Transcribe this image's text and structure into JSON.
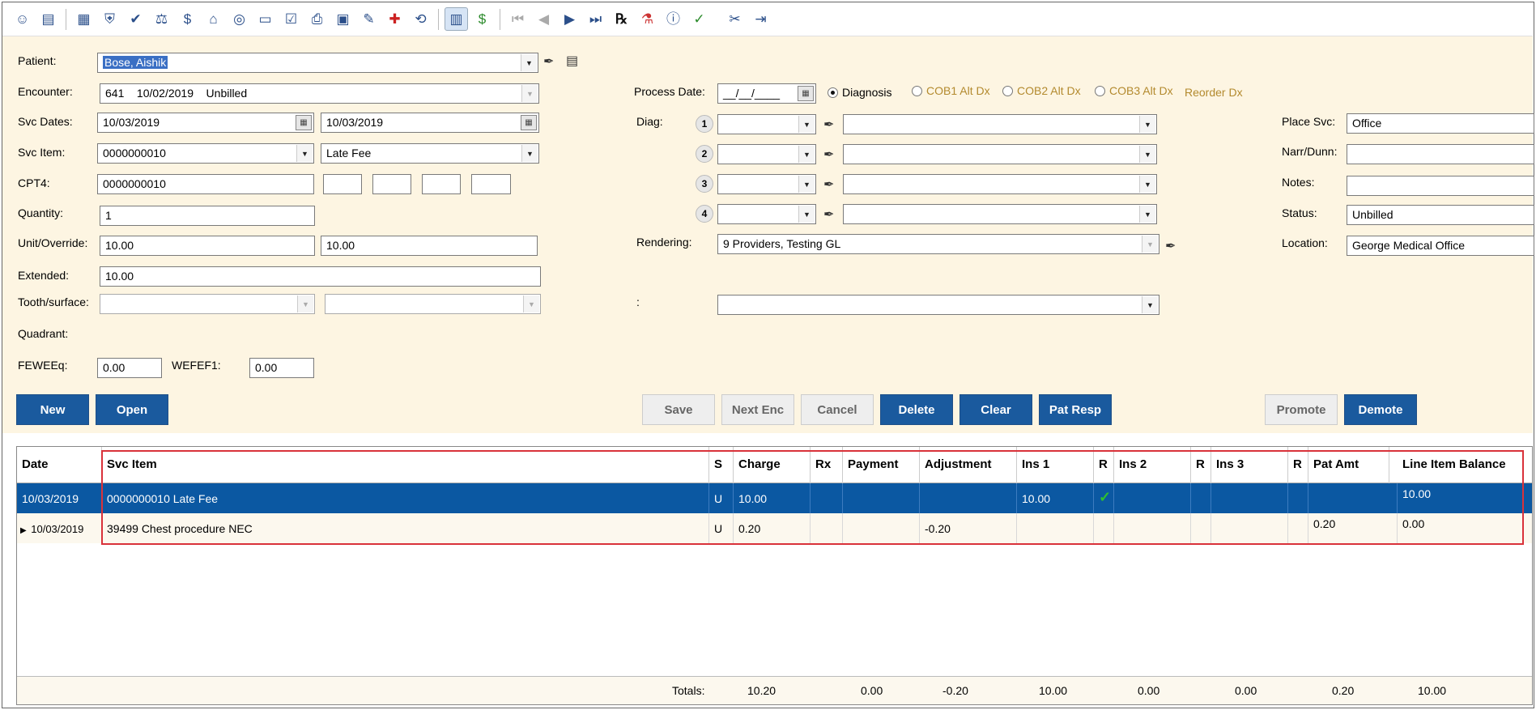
{
  "toolbar": {
    "icons": [
      "patient-icon",
      "card-icon",
      "calendar-grid-icon",
      "shield-icon",
      "shield-check-icon",
      "scales-icon",
      "user-dollar-icon",
      "bank-icon",
      "lifebuoy-icon",
      "ledger-icon",
      "checklist-icon",
      "printer-icon",
      "monitor-icon",
      "tag-icon",
      "medical-plus-icon",
      "reverse-icon",
      "table-icon",
      "dollar-icon",
      "first-icon",
      "prev-icon",
      "next-icon",
      "last-icon",
      "rx-icon",
      "flask-icon",
      "chart-info-icon",
      "chart-check-icon",
      "ticket-icon",
      "exit-icon"
    ]
  },
  "form": {
    "patient_label": "Patient:",
    "patient_value": "Bose, Aishik",
    "encounter_label": "Encounter:",
    "encounter_value": "641    10/02/2019    Unbilled",
    "svc_dates_label": "Svc Dates:",
    "svc_date_from": "10/03/2019",
    "svc_date_to": "10/03/2019",
    "svc_item_label": "Svc Item:",
    "svc_item_code": "0000000010",
    "svc_item_desc": "Late Fee",
    "cpt4_label": "CPT4:",
    "cpt4_value": "0000000010",
    "quantity_label": "Quantity:",
    "quantity_value": "1",
    "unit_override_label": "Unit/Override:",
    "unit_value": "10.00",
    "override_value": "10.00",
    "extended_label": "Extended:",
    "extended_value": "10.00",
    "tooth_label": "Tooth/surface:",
    "quadrant_label": "Quadrant:",
    "feweeq_label": "FEWEEq:",
    "feweeq_value": "0.00",
    "wefef1_label": "WEFEF1:",
    "wefef1_value": "0.00",
    "process_date_label": "Process Date:",
    "process_date_value": "__/__/____",
    "radio_diagnosis": "Diagnosis",
    "radio_cob1": "COB1 Alt Dx",
    "radio_cob2": "COB2 Alt Dx",
    "radio_cob3": "COB3 Alt Dx",
    "reorder_dx": "Reorder Dx",
    "diag_label": "Diag:",
    "diag_numbers": [
      "1",
      "2",
      "3",
      "4"
    ],
    "rendering_label": "Rendering:",
    "rendering_value": "9 Providers, Testing GL",
    "colon_label": ":",
    "place_svc_label": "Place Svc:",
    "place_svc_value": "Office",
    "narr_dunn_label": "Narr/Dunn:",
    "notes_label": "Notes:",
    "status_label": "Status:",
    "status_value": "Unbilled",
    "location_label": "Location:",
    "location_value": "George Medical Office"
  },
  "buttons": {
    "new": "New",
    "open": "Open",
    "save": "Save",
    "next_enc": "Next Enc",
    "cancel": "Cancel",
    "delete": "Delete",
    "clear": "Clear",
    "pat_resp": "Pat Resp",
    "promote": "Promote",
    "demote": "Demote"
  },
  "grid": {
    "headers": [
      "Date",
      "Svc Item",
      "S",
      "Charge",
      "Rx",
      "Payment",
      "Adjustment",
      "Ins 1",
      "R",
      "Ins 2",
      "R",
      "Ins 3",
      "R",
      "Pat Amt",
      "Line Item Balance"
    ],
    "rows": [
      {
        "date": "10/03/2019",
        "svc_item": "0000000010 Late Fee",
        "s": "U",
        "charge": "10.00",
        "rx": "",
        "payment": "",
        "adjustment": "",
        "ins1": "10.00",
        "r1": "✓",
        "ins2": "",
        "r2": "",
        "ins3": "",
        "r3": "",
        "pat_amt": "",
        "balance": "10.00"
      },
      {
        "date": "10/03/2019",
        "svc_item": "39499 Chest procedure NEC",
        "s": "U",
        "charge": "0.20",
        "rx": "",
        "payment": "",
        "adjustment": "-0.20",
        "ins1": "",
        "r1": "",
        "ins2": "",
        "r2": "",
        "ins3": "",
        "r3": "",
        "pat_amt": "0.20",
        "balance": "0.00"
      }
    ],
    "totals": {
      "label": "Totals:",
      "charge": "10.20",
      "payment": "0.00",
      "adjustment": "-0.20",
      "ins1": "10.00",
      "ins2": "0.00",
      "ins3": "0.00",
      "pat_amt": "0.20",
      "balance": "10.00"
    }
  }
}
